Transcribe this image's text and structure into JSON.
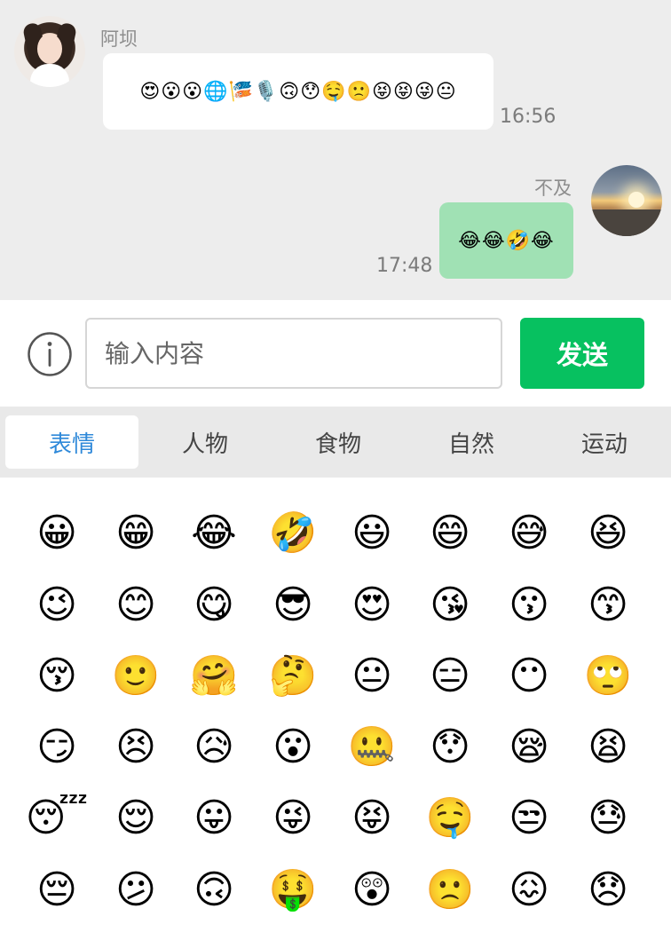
{
  "chat": {
    "messages": [
      {
        "side": "left",
        "sender": "阿坝",
        "content": "😍😮😮🌐🎏🎙️🙃😯🤤🙁😝😝😜😐",
        "time": "16:56"
      },
      {
        "side": "right",
        "sender": "不及",
        "content": "😂😂🤣😂",
        "time": "17:48"
      }
    ]
  },
  "composer": {
    "placeholder": "输入内容",
    "value": "",
    "send_label": "发送",
    "info_icon": "info-icon"
  },
  "tabs": [
    {
      "label": "表情",
      "active": true
    },
    {
      "label": "人物",
      "active": false
    },
    {
      "label": "食物",
      "active": false
    },
    {
      "label": "自然",
      "active": false
    },
    {
      "label": "运动",
      "active": false
    }
  ],
  "emoji_grid": [
    [
      "😀",
      "😁",
      "😂",
      "🤣",
      "😃",
      "😄",
      "😅",
      "😆"
    ],
    [
      "😉",
      "😊",
      "😋",
      "😎",
      "😍",
      "😘",
      "😗",
      "😙"
    ],
    [
      "😚",
      "🙂",
      "🤗",
      "🤔",
      "😐",
      "😑",
      "😶",
      "🙄"
    ],
    [
      "😏",
      "😣",
      "😥",
      "😮",
      "🤐",
      "😯",
      "😪",
      "😫"
    ],
    [
      "😴",
      "😌",
      "😛",
      "😜",
      "😝",
      "🤤",
      "😒",
      "😓"
    ],
    [
      "😔",
      "😕",
      "🙃",
      "🤑",
      "😲",
      "🙁",
      "😖",
      "😞"
    ]
  ],
  "colors": {
    "send_button": "#07c160",
    "active_tab_text": "#2f89d9",
    "own_bubble": "#a0e1b4",
    "chat_background": "#ededed"
  }
}
